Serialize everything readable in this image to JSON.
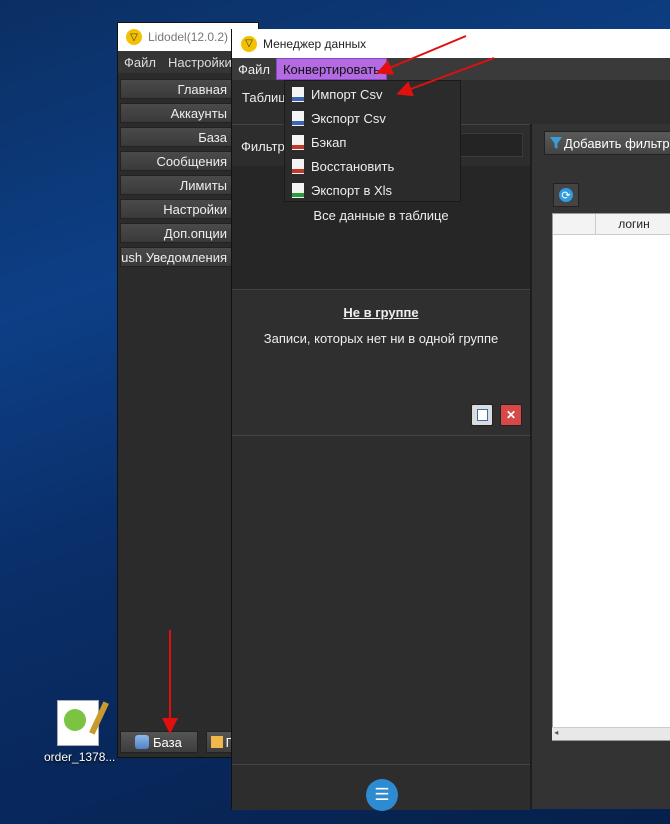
{
  "desktop": {
    "file_label": "order_1378..."
  },
  "back_window": {
    "title": "Lidodel(12.0.2)",
    "menu": [
      "Файл",
      "Настройки"
    ],
    "buttons": [
      "Главная",
      "Аккаунты",
      "База",
      "Сообщения",
      "Лимиты",
      "Настройки",
      "Доп.опции",
      "Push Уведомления"
    ],
    "bottom_buttons": [
      "База",
      "П"
    ]
  },
  "front_window": {
    "title": "Менеджер данных",
    "menu": [
      "Файл",
      "Конвертировать"
    ],
    "tab_label": "Таблицы",
    "filter_label": "Фильтр",
    "group_all": "Все данные в таблице",
    "group_none_title": "Не в группе",
    "group_none_desc": "Записи, которых нет ни в одной группе",
    "add_filter_label": "Добавить фильтр",
    "grid_columns": [
      "",
      "логин"
    ]
  },
  "dropdown": {
    "items": [
      {
        "label": "Импорт Csv",
        "icon": "csv-file-icon"
      },
      {
        "label": "Экспорт Csv",
        "icon": "csv-file-icon"
      },
      {
        "label": "Бэкап",
        "icon": "sql-file-icon"
      },
      {
        "label": "Восстановить",
        "icon": "sql-file-icon"
      },
      {
        "label": "Экспорт в Xls",
        "icon": "xls-file-icon"
      }
    ]
  },
  "colors": {
    "menu_highlight": "#b26be0",
    "arrow": "#e01010",
    "accent_blue": "#2c8bd1"
  }
}
